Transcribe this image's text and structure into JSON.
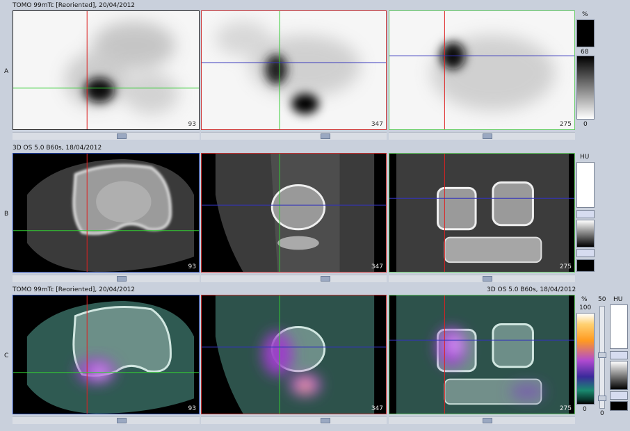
{
  "rowA": {
    "label": "A",
    "title": "TOMO 99mTc [Reoriented], 20/04/2012",
    "panels": [
      {
        "number": "93"
      },
      {
        "number": "347"
      },
      {
        "number": "275"
      }
    ],
    "scale": {
      "unit": "%",
      "mid": "68",
      "min": "0"
    }
  },
  "rowB": {
    "label": "B",
    "title": "3D  OS  5.0  B60s, 18/04/2012",
    "panels": [
      {
        "number": "93"
      },
      {
        "number": "347"
      },
      {
        "number": "275"
      }
    ],
    "scale": {
      "unit": "HU"
    }
  },
  "rowC": {
    "label": "C",
    "title_left": "TOMO 99mTc [Reoriented], 20/04/2012",
    "title_right": "3D  OS  5.0  B60s, 18/04/2012",
    "panels": [
      {
        "number": "93"
      },
      {
        "number": "347"
      },
      {
        "number": "275"
      }
    ],
    "scale_pct": {
      "unit": "%",
      "max": "100",
      "min": "0"
    },
    "slider_value": "50",
    "slider_min": "0",
    "scale_hu": {
      "unit": "HU"
    }
  }
}
